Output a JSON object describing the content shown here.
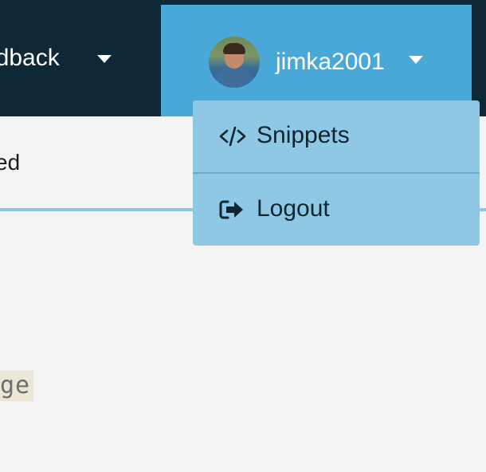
{
  "navbar": {
    "feedback_label": "edback",
    "user": {
      "username": "jimka2001",
      "avatar": "user-photo"
    }
  },
  "subbar": {
    "text": "ed"
  },
  "content": {
    "code_chip_text": "ge"
  },
  "dropdown": {
    "items": [
      {
        "label": "Snippets",
        "icon": "code-icon"
      },
      {
        "label": "Logout",
        "icon": "logout-icon"
      }
    ]
  },
  "colors": {
    "navbar_bg": "#0e2835",
    "user_menu_bg": "#4aa8d8",
    "dropdown_bg": "#8ec8e5",
    "divider": "#6aa9c9",
    "page_bg": "#f4f4f4",
    "accent_line": "#8cc7e5",
    "code_chip_bg": "#ece6d6"
  }
}
